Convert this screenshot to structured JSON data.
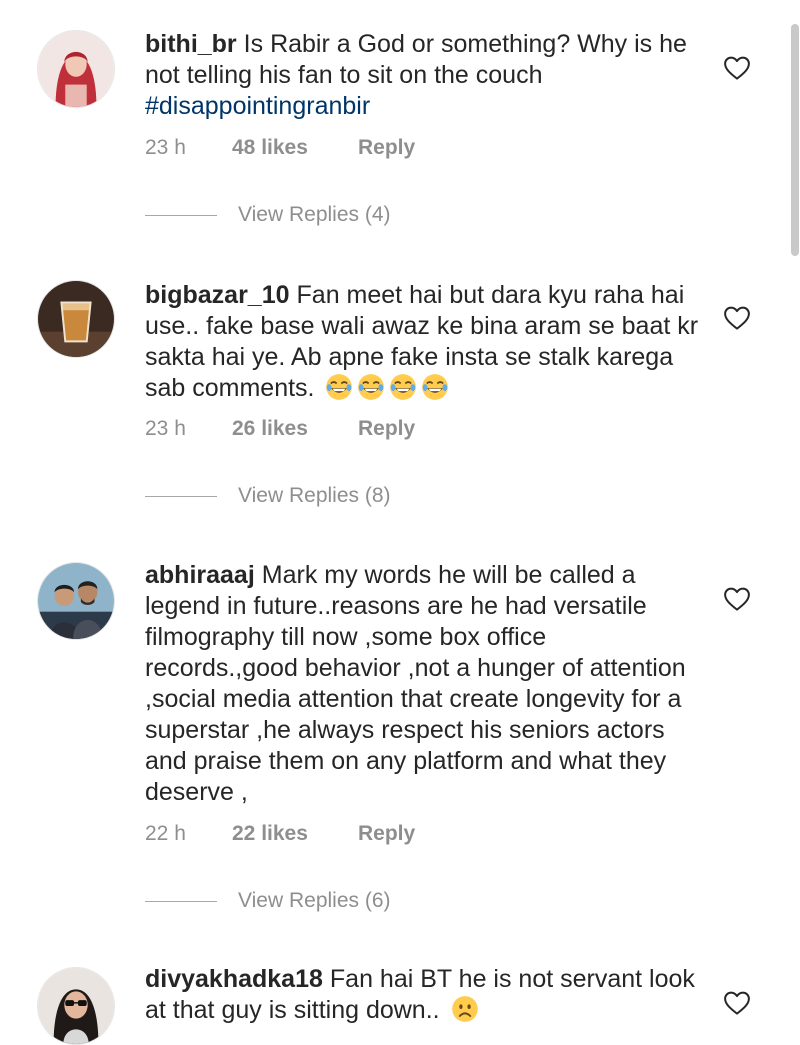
{
  "comments": [
    {
      "username": "bithi_br",
      "text": "Is Rabir a God or something? Why is he not telling his fan to sit on the couch",
      "hashtag": "#disappointingranbir",
      "time": "23 h",
      "likes": "48 likes",
      "reply_label": "Reply",
      "view_replies": "View Replies (4)",
      "avatar_icon": "profile-photo-woman-red-hair"
    },
    {
      "username": "bigbazar_10",
      "text": "Fan meet hai but dara kyu raha hai use.. fake base wali awaz ke bina aram se baat kr sakta hai ye. Ab apne fake insta se stalk karega sab comments.",
      "emoji": "😂😂😂😂",
      "time": "23 h",
      "likes": "26 likes",
      "reply_label": "Reply",
      "view_replies": "View Replies (8)",
      "avatar_icon": "profile-photo-tea-glass"
    },
    {
      "username": "abhiraaaj",
      "text": "Mark my words he will be called a legend in future..reasons are he had versatile filmography till now ,some box office records.,good behavior ,not a hunger of attention ,social media attention that create longevity for a superstar ,he always respect his seniors actors and praise them on any platform and what they deserve ,",
      "time": "22 h",
      "likes": "22 likes",
      "reply_label": "Reply",
      "view_replies": "View Replies (6)",
      "avatar_icon": "profile-photo-two-men"
    },
    {
      "username": "divyakhadka18",
      "text": "Fan hai BT he is not servant look at that guy is sitting down..",
      "emoji": "😟",
      "avatar_icon": "profile-photo-woman-sunglasses"
    }
  ],
  "colors": {
    "text": "#262626",
    "meta": "#8e8e8e",
    "hashtag": "#003569",
    "divider": "#a8a8a8"
  },
  "icons": {
    "like": "heart-outline-icon",
    "laugh": "face-with-tears-of-joy-emoji",
    "worried": "worried-face-emoji"
  }
}
